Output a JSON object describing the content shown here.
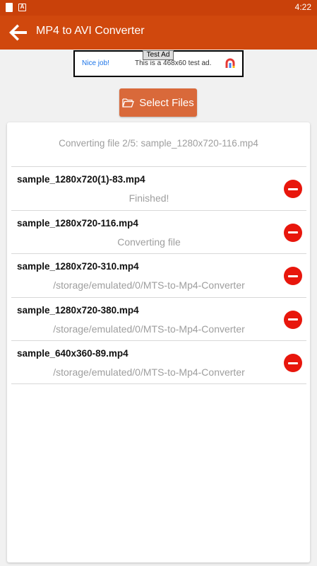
{
  "status_bar": {
    "time": "4:22",
    "notif_icon2_letter": "A"
  },
  "app_bar": {
    "title": "MP4 to AVI Converter",
    "back_icon": "arrow-left-icon"
  },
  "ad": {
    "tag": "Test Ad",
    "nice": "Nice job!",
    "text": "This is a 468x60 test ad.",
    "logo_icon": "ad-choices-icon"
  },
  "select_button": {
    "label": "Select Files",
    "icon": "folder-open-icon"
  },
  "status_line": "Converting file 2/5: sample_1280x720-116.mp4",
  "files": [
    {
      "name": "sample_1280x720(1)-83.mp4",
      "sub": "Finished!"
    },
    {
      "name": "sample_1280x720-116.mp4",
      "sub": "Converting file"
    },
    {
      "name": "sample_1280x720-310.mp4",
      "sub": "/storage/emulated/0/MTS-to-Mp4-Converter"
    },
    {
      "name": "sample_1280x720-380.mp4",
      "sub": "/storage/emulated/0/MTS-to-Mp4-Converter"
    },
    {
      "name": "sample_640x360-89.mp4",
      "sub": "/storage/emulated/0/MTS-to-Mp4-Converter"
    }
  ],
  "colors": {
    "status_bar": "#c9410a",
    "app_bar": "#d0480d",
    "button": "#d9693a",
    "remove": "#e8160c"
  }
}
